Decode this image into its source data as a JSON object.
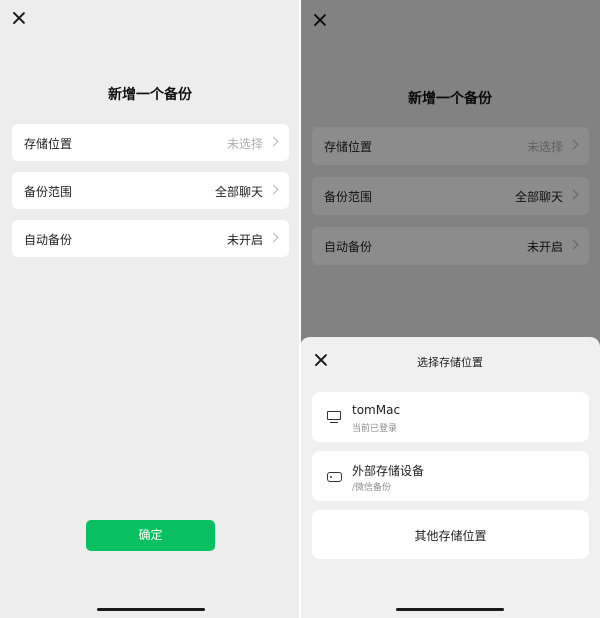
{
  "left": {
    "title": "新增一个备份",
    "rows": [
      {
        "label": "存储位置",
        "value": "未选择"
      },
      {
        "label": "备份范围",
        "value": "全部聊天"
      },
      {
        "label": "自动备份",
        "value": "未开启"
      }
    ],
    "confirm_label": "确定"
  },
  "right": {
    "title": "新增一个备份",
    "rows": [
      {
        "label": "存储位置",
        "value": "未选择"
      },
      {
        "label": "备份范围",
        "value": "全部聊天"
      },
      {
        "label": "自动备份",
        "value": "未开启"
      }
    ],
    "sheet": {
      "title": "选择存储位置",
      "options": [
        {
          "name": "tomMac",
          "sub": "当前已登录",
          "icon": "monitor-icon"
        },
        {
          "name": "外部存储设备",
          "sub": "/微信备份",
          "icon": "drive-icon"
        }
      ],
      "other_label": "其他存储位置"
    }
  },
  "colors": {
    "accent": "#07c160",
    "background": "#ededed",
    "muted_text": "#b0b0b0"
  }
}
